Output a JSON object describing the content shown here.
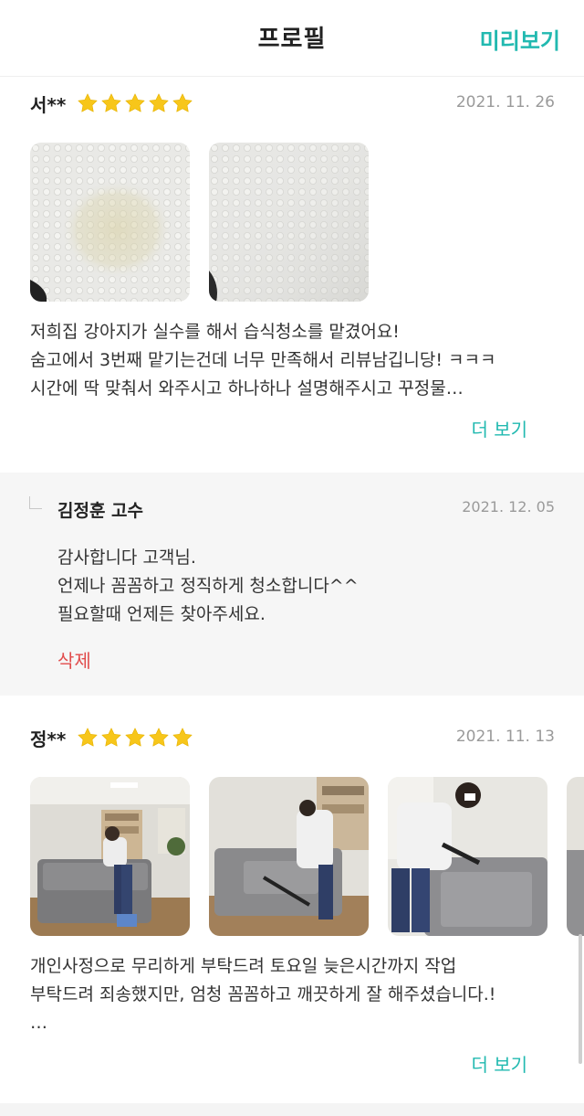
{
  "header": {
    "title": "프로필",
    "preview_label": "미리보기"
  },
  "reviews": [
    {
      "reviewer": "서**",
      "rating": 5,
      "date": "2021. 11. 26",
      "text_lines": [
        "저희집 강아지가 실수를 해서 습식청소를 맡겼어요!",
        "숨고에서 3번째 맡기는건데 너무 만족해서 리뷰남깁니당! ㅋㅋㅋ",
        "시간에 딱 맞춰서 와주시고 하나하나 설명해주시고 꾸정물…"
      ],
      "more_label": "더 보기"
    },
    {
      "reviewer": "정**",
      "rating": 5,
      "date": "2021. 11. 13",
      "text_lines": [
        "개인사정으로 무리하게 부탁드려 토요일 늦은시간까지 작업",
        "부탁드려 죄송했지만, 엄청 꼼꼼하고 깨끗하게 잘 해주셨습니다.!",
        "…"
      ],
      "more_label": "더 보기"
    }
  ],
  "reply": {
    "name": "김정훈 고수",
    "date": "2021. 12. 05",
    "text_lines": [
      "감사합니다 고객님.",
      "언제나 꼼꼼하고 정직하게 청소합니다^^",
      "필요할때 언제든 찾아주세요."
    ],
    "delete_label": "삭제"
  },
  "colors": {
    "accent": "#21b9b0",
    "star": "#f7c61a",
    "delete": "#e14b4b"
  },
  "icons": {
    "star": "star-icon",
    "reply": "reply-corner-icon"
  }
}
